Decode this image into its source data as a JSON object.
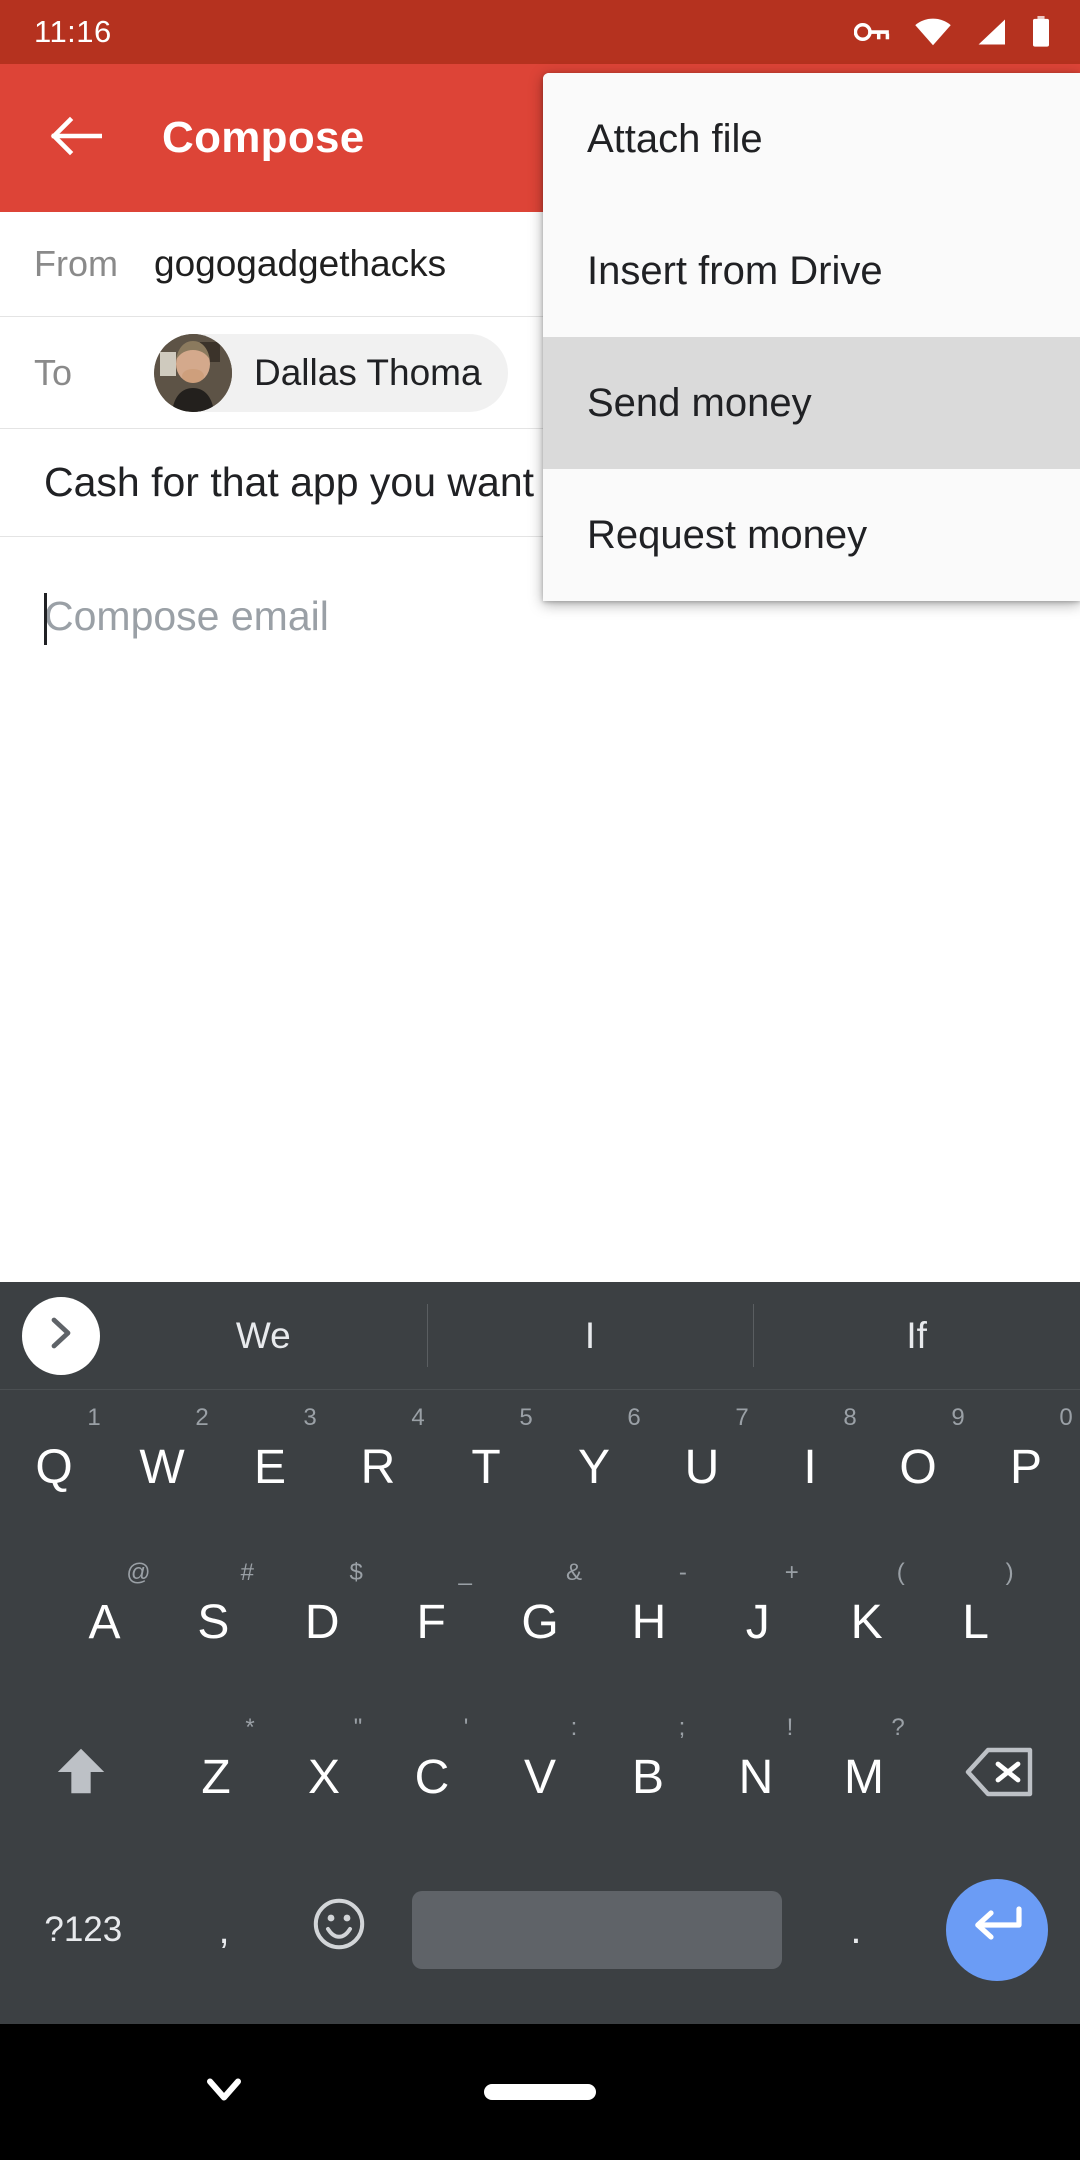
{
  "status_bar": {
    "time": "11:16",
    "icons": [
      "vpn-key-icon",
      "wifi-icon",
      "signal-icon",
      "battery-icon"
    ],
    "background": "#b5321f"
  },
  "app_bar": {
    "title": "Compose",
    "back_icon": "arrow-left-icon",
    "background": "#dd4437"
  },
  "compose": {
    "from_label": "From",
    "from_value": "gogogadgethacks",
    "to_label": "To",
    "to_chip_name": "Dallas Thoma",
    "subject": "Cash for that app you want",
    "body_placeholder": "Compose email"
  },
  "menu": {
    "items": [
      {
        "label": "Attach file",
        "selected": false
      },
      {
        "label": "Insert from Drive",
        "selected": false
      },
      {
        "label": "Send money",
        "selected": true
      },
      {
        "label": "Request money",
        "selected": false
      }
    ],
    "selected_background": "#dadada",
    "background": "#fafafa"
  },
  "keyboard": {
    "background": "#3c4043",
    "expand_icon": "chevron-right-icon",
    "suggestions": [
      "We",
      "I",
      "If"
    ],
    "row1": [
      {
        "key": "Q",
        "hint": "1"
      },
      {
        "key": "W",
        "hint": "2"
      },
      {
        "key": "E",
        "hint": "3"
      },
      {
        "key": "R",
        "hint": "4"
      },
      {
        "key": "T",
        "hint": "5"
      },
      {
        "key": "Y",
        "hint": "6"
      },
      {
        "key": "U",
        "hint": "7"
      },
      {
        "key": "I",
        "hint": "8"
      },
      {
        "key": "O",
        "hint": "9"
      },
      {
        "key": "P",
        "hint": "0"
      }
    ],
    "row2": [
      {
        "key": "A",
        "hint": "@"
      },
      {
        "key": "S",
        "hint": "#"
      },
      {
        "key": "D",
        "hint": "$"
      },
      {
        "key": "F",
        "hint": "_"
      },
      {
        "key": "G",
        "hint": "&"
      },
      {
        "key": "H",
        "hint": "-"
      },
      {
        "key": "J",
        "hint": "+"
      },
      {
        "key": "K",
        "hint": "("
      },
      {
        "key": "L",
        "hint": ")"
      }
    ],
    "row3": [
      {
        "key": "Z",
        "hint": "*"
      },
      {
        "key": "X",
        "hint": "\""
      },
      {
        "key": "C",
        "hint": "'"
      },
      {
        "key": "V",
        "hint": ":"
      },
      {
        "key": "B",
        "hint": ";"
      },
      {
        "key": "N",
        "hint": "!"
      },
      {
        "key": "M",
        "hint": "?"
      }
    ],
    "shift_icon": "shift-arrow-up-icon",
    "backspace_icon": "backspace-icon",
    "symbols_key": "?123",
    "comma_key": ",",
    "emoji_icon": "emoji-smiley-icon",
    "space_key": "",
    "period_key": ".",
    "enter_icon": "enter-return-icon",
    "enter_background": "#6b9cf5",
    "spacebar_background": "#5f6368"
  },
  "nav_bar": {
    "back_icon": "chevron-down-icon",
    "home_icon": "home-pill-icon"
  }
}
